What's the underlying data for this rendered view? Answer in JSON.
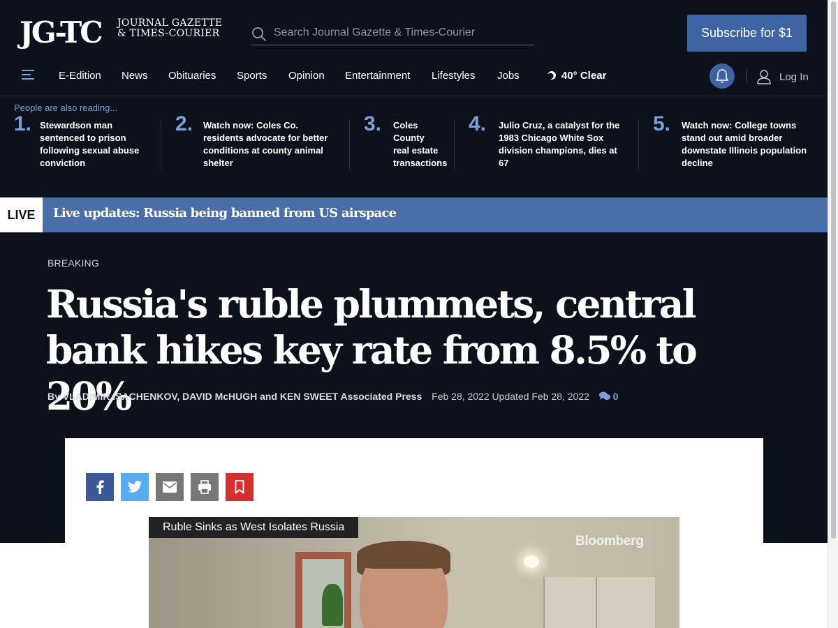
{
  "header": {
    "logo_mark": "JG-TC",
    "logo_name_line1": "JOURNAL GAZETTE",
    "logo_name_line2": "& TIMES-COURIER",
    "search_placeholder": "Search Journal Gazette & Times-Courier",
    "subscribe_label": "Subscribe for $1"
  },
  "nav": {
    "items": [
      "E-Edition",
      "News",
      "Obituaries",
      "Sports",
      "Opinion",
      "Entertainment",
      "Lifestyles",
      "Jobs"
    ],
    "weather": "40° Clear",
    "login_label": "Log In"
  },
  "also_reading": {
    "label": "People are also reading...",
    "items": [
      {
        "num": "1.",
        "text": "Stewardson man sentenced to prison following sexual abuse conviction"
      },
      {
        "num": "2.",
        "text": "Watch now: Coles Co. residents advocate for better conditions at county animal shelter"
      },
      {
        "num": "3.",
        "text": "Coles County real estate transactions"
      },
      {
        "num": "4.",
        "text": "Julio Cruz, a catalyst for the 1983 Chicago White Sox division champions, dies at 67"
      },
      {
        "num": "5.",
        "text": "Watch now: College towns stand out amid broader downstate Illinois population decline"
      }
    ]
  },
  "live": {
    "tag": "LIVE",
    "headline": "Live updates: Russia being banned from US airspace"
  },
  "article": {
    "kicker": "BREAKING",
    "title": "Russia's ruble plummets, central bank hikes key rate from 8.5% to 20%",
    "byline": "By VLADIMIR ISACHENKOV, DAVID McHUGH and KEN SWEET Associated Press",
    "date": "Feb 28, 2022 Updated Feb 28, 2022",
    "comment_count": "0"
  },
  "share_icons": [
    "facebook-icon",
    "twitter-icon",
    "email-icon",
    "print-icon",
    "bookmark-icon"
  ],
  "video": {
    "caption": "Ruble Sinks as West Isolates Russia",
    "brand": "Bloomberg"
  },
  "colors": {
    "background": "#0c111c",
    "accent": "#3f64a4",
    "live_bar": "#4a6ea8",
    "link_blue": "#7f9fd8"
  }
}
